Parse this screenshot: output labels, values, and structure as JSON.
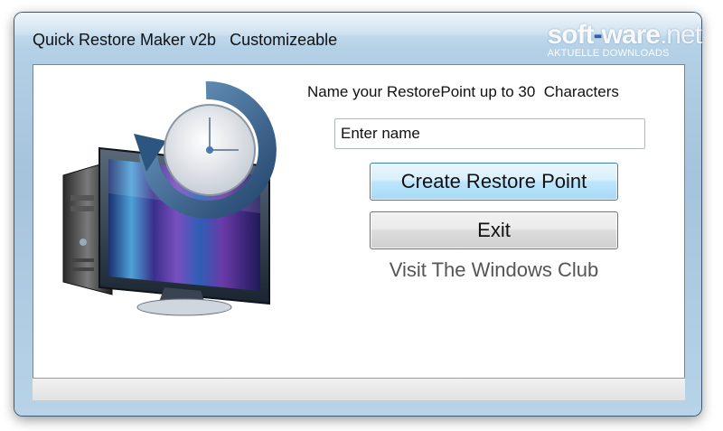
{
  "window": {
    "title": "Quick Restore Maker v2b   Customizeable"
  },
  "main": {
    "prompt": "Name your RestorePoint up to 30  Characters",
    "name_input": {
      "value": "Enter name"
    },
    "create_button": "Create Restore Point",
    "exit_button": "Exit",
    "link": "Visit The Windows Club",
    "illustration": "computer-restore-clock-icon"
  },
  "watermark": {
    "part1": "soft",
    "dash": "-",
    "part2": "ware",
    "part3": ".net",
    "sub": "AKTUELLE DOWNLOADS"
  },
  "colors": {
    "window_frame": "#a5c3dc",
    "accent_button": "#bee6fd",
    "link_text": "#555555"
  }
}
